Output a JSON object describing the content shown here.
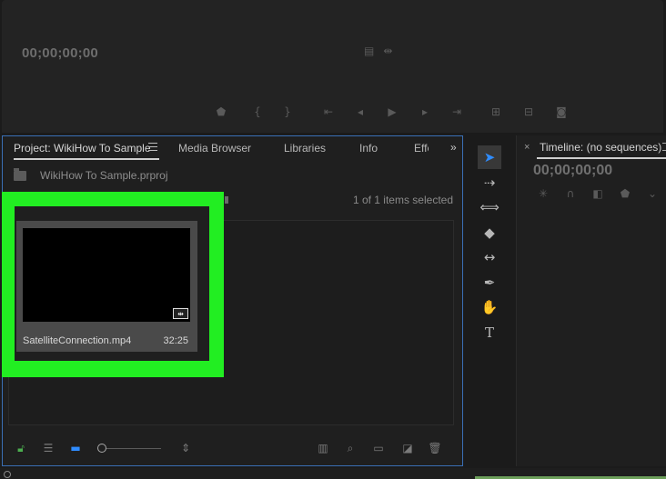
{
  "program_monitor": {
    "timecode": "00;00;00;00",
    "top_icons": [
      "export-frame-icon",
      "audio-scrub-icon"
    ],
    "transport_icons": [
      "marker-icon",
      "mark-in-icon",
      "mark-out-icon",
      "go-to-in-icon",
      "step-back-icon",
      "play-icon",
      "step-forward-icon",
      "go-to-out-icon",
      "lift-icon",
      "extract-icon",
      "export-frame-camera-icon"
    ]
  },
  "project_panel": {
    "tabs": [
      "Project: WikiHow To Sample",
      "Media Browser",
      "Libraries",
      "Info",
      "Effe"
    ],
    "overflow": "»",
    "bin_path": "WikiHow To Sample.prproj",
    "items_selected": "1 of 1 items selected",
    "clip": {
      "name": "SatelliteConnection.mp4",
      "duration": "32:25"
    },
    "bottom_icons": [
      "lock-icon",
      "list-view-icon",
      "icon-view-icon",
      "zoom-slider",
      "sort-icon",
      "automate-icon",
      "find-icon",
      "new-bin-icon",
      "new-item-icon",
      "clear-icon"
    ],
    "zoom_level": 0
  },
  "tools": [
    "selection-tool",
    "track-select-tool",
    "ripple-edit-tool",
    "razor-tool",
    "slip-tool",
    "pen-tool",
    "hand-tool",
    "type-tool"
  ],
  "timeline_panel": {
    "title": "Timeline: (no sequences)",
    "timecode": "00;00;00;00"
  },
  "colors": {
    "highlight": "#22ee22",
    "accent": "#2f8cff",
    "panel_border": "#3a6fb5"
  }
}
